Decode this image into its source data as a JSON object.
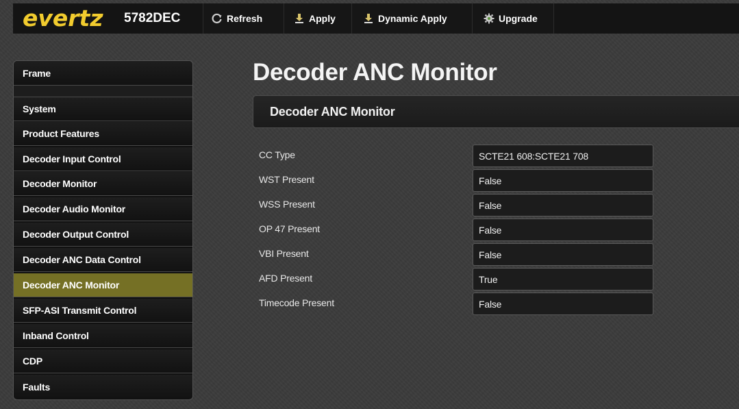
{
  "header": {
    "logo_text": "evertz",
    "model": "5782DEC",
    "buttons": [
      {
        "label": "Refresh",
        "icon": "refresh-icon"
      },
      {
        "label": "Apply",
        "icon": "download-arrow-icon"
      },
      {
        "label": "Dynamic Apply",
        "icon": "download-arrow-icon"
      },
      {
        "label": "Upgrade",
        "icon": "gear-icon"
      }
    ]
  },
  "sidebar": {
    "items": [
      {
        "label": "Frame",
        "active": false
      },
      {
        "label": "System",
        "active": false
      },
      {
        "label": "Product Features",
        "active": false
      },
      {
        "label": "Decoder Input Control",
        "active": false
      },
      {
        "label": "Decoder Monitor",
        "active": false
      },
      {
        "label": "Decoder Audio Monitor",
        "active": false
      },
      {
        "label": "Decoder Output Control",
        "active": false
      },
      {
        "label": "Decoder ANC Data Control",
        "active": false
      },
      {
        "label": "Decoder ANC Monitor",
        "active": true
      },
      {
        "label": "SFP-ASI Transmit Control",
        "active": false
      },
      {
        "label": "Inband Control",
        "active": false
      },
      {
        "label": "CDP",
        "active": false
      },
      {
        "label": "Faults",
        "active": false
      }
    ]
  },
  "main": {
    "page_title": "Decoder ANC Monitor",
    "section_title": "Decoder ANC Monitor",
    "fields": [
      {
        "label": "CC Type",
        "value": "SCTE21 608:SCTE21 708"
      },
      {
        "label": "WST Present",
        "value": "False"
      },
      {
        "label": "WSS Present",
        "value": "False"
      },
      {
        "label": "OP 47 Present",
        "value": "False"
      },
      {
        "label": "VBI Present",
        "value": "False"
      },
      {
        "label": "AFD Present",
        "value": "True"
      },
      {
        "label": "Timecode Present",
        "value": "False"
      }
    ]
  },
  "colors": {
    "logo": "#f2cc2e",
    "active_item": "#757025",
    "background": "#3b3b3b",
    "topbar": "#141414"
  }
}
